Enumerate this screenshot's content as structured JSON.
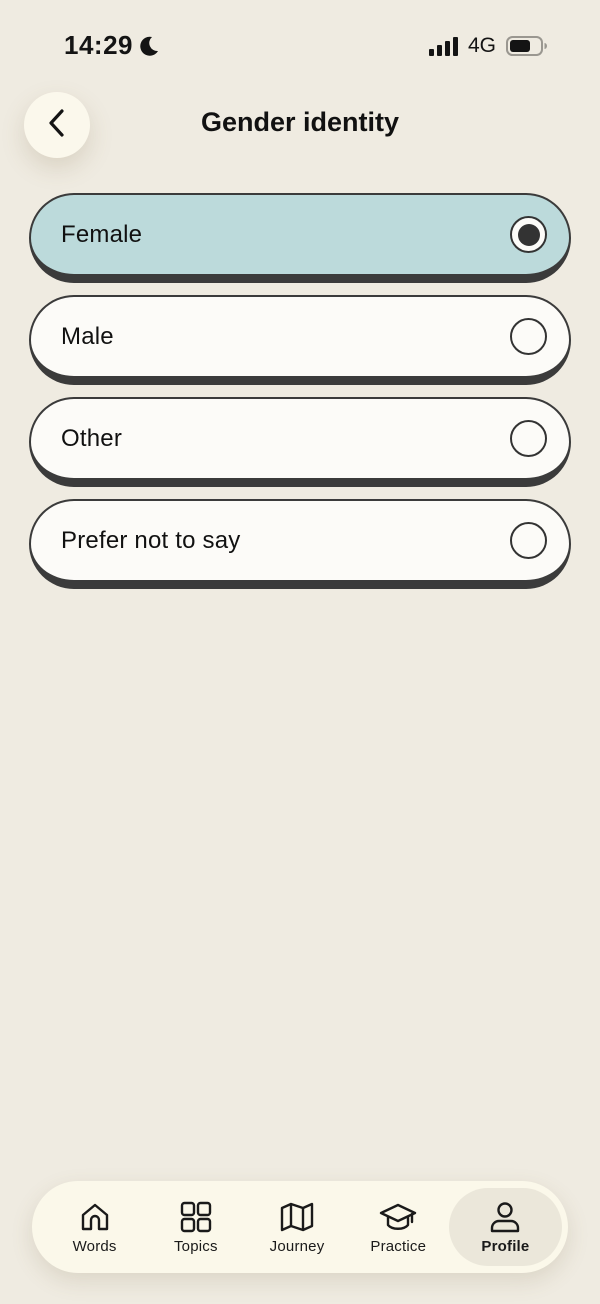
{
  "status_bar": {
    "time": "14:29",
    "network": "4G",
    "icons": [
      "moon-icon",
      "signal-icon",
      "battery-icon"
    ]
  },
  "header": {
    "title": "Gender identity",
    "back_icon": "chevron-left-icon"
  },
  "options": [
    {
      "label": "Female",
      "selected": true
    },
    {
      "label": "Male",
      "selected": false
    },
    {
      "label": "Other",
      "selected": false
    },
    {
      "label": "Prefer not to say",
      "selected": false
    }
  ],
  "tab_bar": {
    "tabs": [
      {
        "label": "Words",
        "icon": "home-icon",
        "active": false
      },
      {
        "label": "Topics",
        "icon": "grid-icon",
        "active": false
      },
      {
        "label": "Journey",
        "icon": "map-icon",
        "active": false
      },
      {
        "label": "Practice",
        "icon": "graduation-cap-icon",
        "active": false
      },
      {
        "label": "Profile",
        "icon": "user-icon",
        "active": true
      }
    ]
  },
  "colors": {
    "background": "#efebe1",
    "selected_option": "#bcdadb",
    "option": "#fcfbf8",
    "tab_bar": "#fbf8ea",
    "active_tab": "#ebe7da"
  }
}
